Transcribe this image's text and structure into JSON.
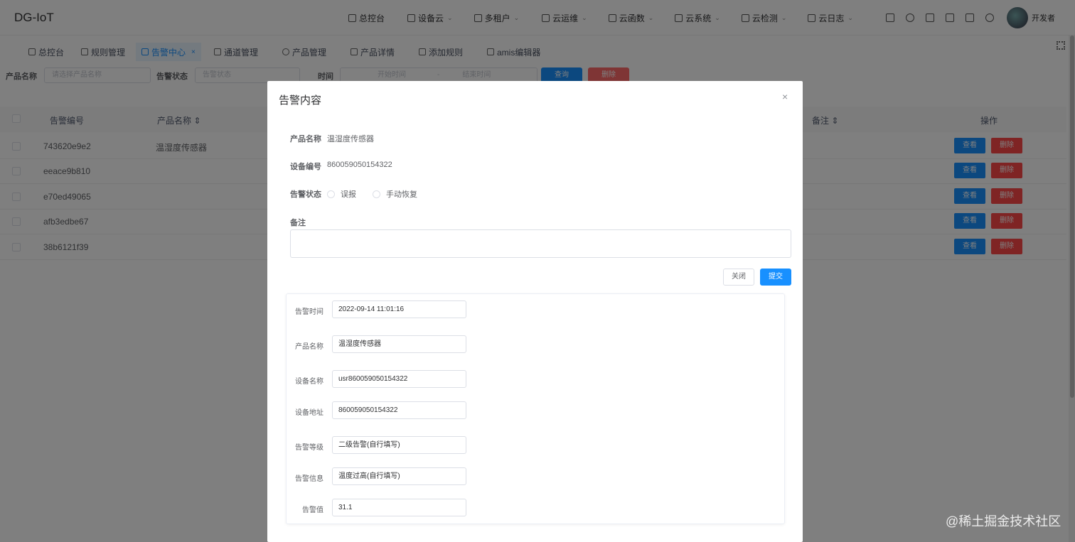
{
  "app": {
    "logo": "DG-IoT",
    "username": "开发者"
  },
  "topnav": [
    {
      "label": "总控台",
      "chevron": ""
    },
    {
      "label": "设备云",
      "chevron": "⌄"
    },
    {
      "label": "多租户",
      "chevron": "⌄"
    },
    {
      "label": "云运维",
      "chevron": "⌄"
    },
    {
      "label": "云函数",
      "chevron": "⌄"
    },
    {
      "label": "云系统",
      "chevron": "⌄"
    },
    {
      "label": "云检测",
      "chevron": "⌄"
    },
    {
      "label": "云日志",
      "chevron": "⌄"
    }
  ],
  "tags": [
    {
      "label": "总控台"
    },
    {
      "label": "规则管理"
    },
    {
      "label": "告警中心",
      "close": "×"
    },
    {
      "label": "通道管理"
    },
    {
      "label": "产品管理"
    },
    {
      "label": "产品详情"
    },
    {
      "label": "添加规则"
    },
    {
      "label": "amis编辑器"
    }
  ],
  "search": {
    "product_label": "产品名称",
    "product_placeholder": "请选择产品名称",
    "status_label": "告警状态",
    "status_placeholder": "告警状态",
    "time_label": "时间",
    "start_placeholder": "开始时间",
    "range_sep": "-",
    "end_placeholder": "结束时间",
    "query_button": "查询",
    "delete_button": "删除"
  },
  "table": {
    "headers": {
      "alarm_no": "告警编号",
      "product_name": "产品名称",
      "remark": "备注",
      "actions": "操作"
    },
    "sort_icon": "⇕",
    "rows": [
      {
        "alarm_no": "743620e9e2",
        "product_name": "温湿度传感器"
      },
      {
        "alarm_no": "eeace9b810",
        "product_name": ""
      },
      {
        "alarm_no": "e70ed49065",
        "product_name": ""
      },
      {
        "alarm_no": "afb3edbe67",
        "product_name": ""
      },
      {
        "alarm_no": "38b6121f39",
        "product_name": ""
      }
    ],
    "view_button": "查看",
    "delete_button": "删除"
  },
  "dialog": {
    "title": "告警内容",
    "close_icon": "×",
    "product_name_label": "产品名称",
    "product_name_value": "温湿度传感器",
    "device_no_label": "设备编号",
    "device_no_value": "860059050154322",
    "status_label": "告警状态",
    "status_options": [
      "误报",
      "手动恢复"
    ],
    "remark_label": "备注",
    "remark_value": "",
    "close_button": "关闭",
    "submit_button": "提交",
    "details": [
      {
        "label": "告警时间",
        "value": "2022-09-14 11:01:16"
      },
      {
        "label": "产品名称",
        "value": "温湿度传感器"
      },
      {
        "label": "设备名称",
        "value": "usr860059050154322"
      },
      {
        "label": "设备地址",
        "value": "860059050154322"
      },
      {
        "label": "告警等级",
        "value": "二级告警(自行填写)"
      },
      {
        "label": "告警信息",
        "value": "温度过高(自行填写)"
      },
      {
        "label": "告警值",
        "value": "31.1"
      }
    ]
  },
  "watermark": "@稀土掘金技术社区",
  "colors": {
    "primary": "#1890ff",
    "danger": "#ff4949",
    "overlay": "rgba(0,0,0,0.5)"
  }
}
